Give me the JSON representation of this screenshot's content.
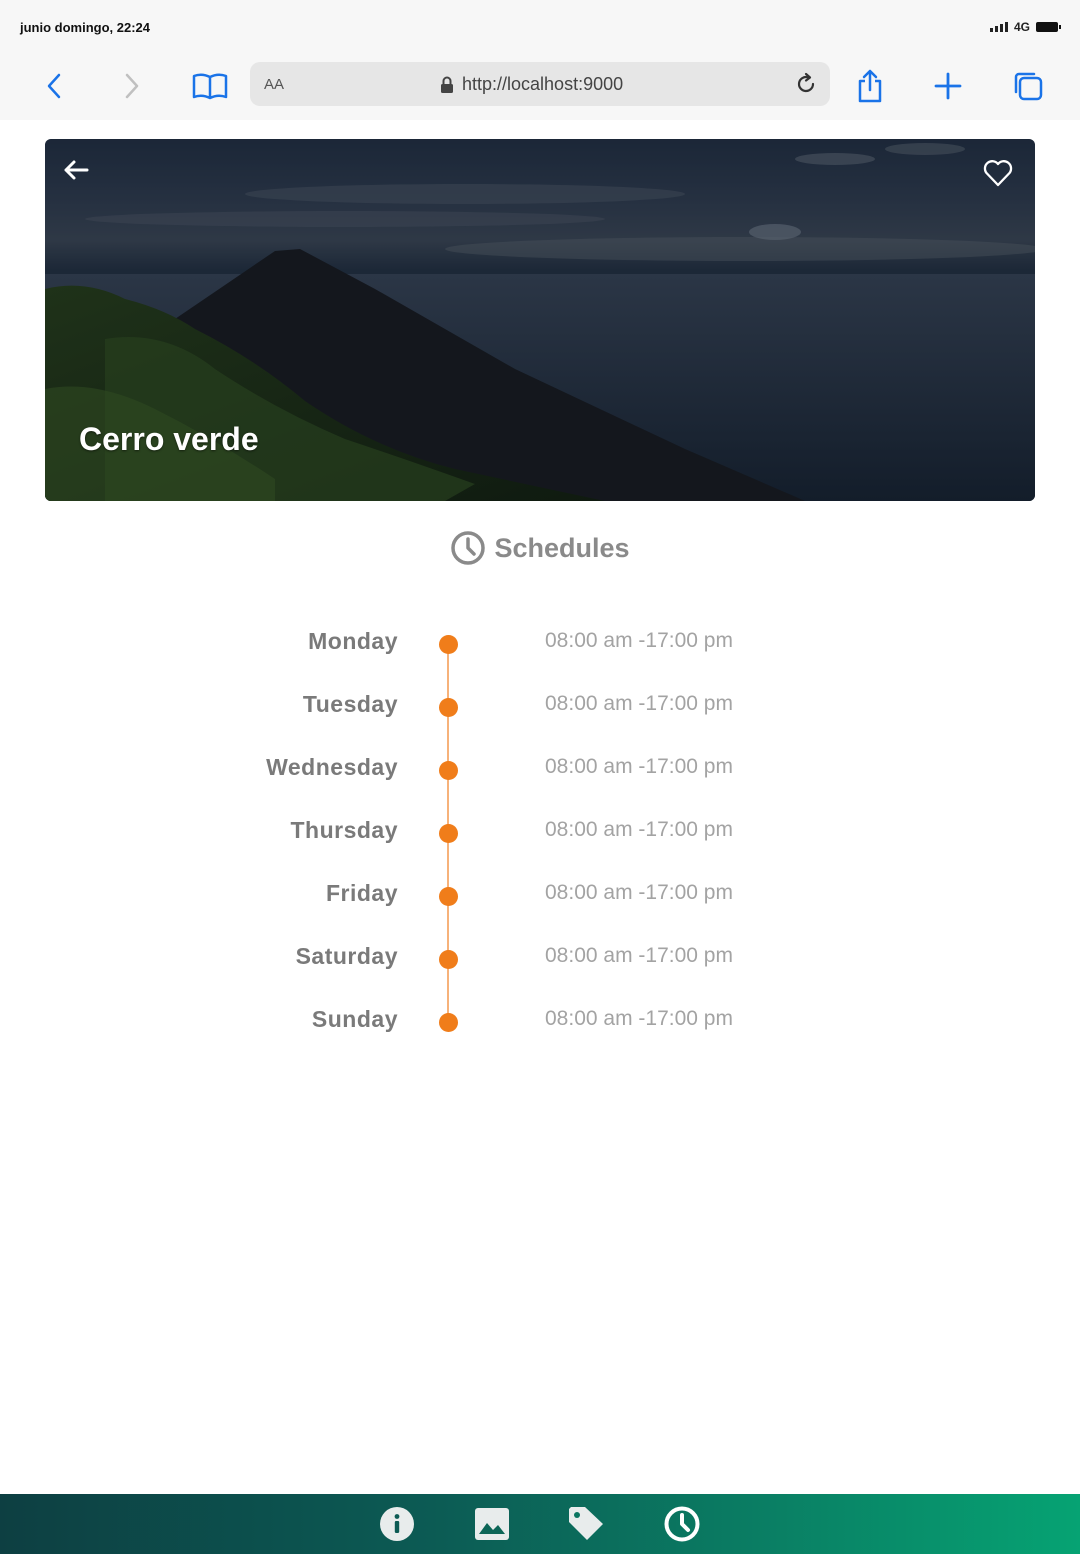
{
  "status_bar": {
    "time": "junio domingo, 22:24",
    "network": "4G"
  },
  "browser": {
    "text_size_label": "AA",
    "url": "http://localhost:9000"
  },
  "place": {
    "name": "Cerro verde"
  },
  "schedules": {
    "heading": "Schedules",
    "days": [
      {
        "day": "Monday",
        "hours": "08:00 am -17:00 pm"
      },
      {
        "day": "Tuesday",
        "hours": "08:00 am -17:00 pm"
      },
      {
        "day": "Wednesday",
        "hours": "08:00 am -17:00 pm"
      },
      {
        "day": "Thursday",
        "hours": "08:00 am -17:00 pm"
      },
      {
        "day": "Friday",
        "hours": "08:00 am -17:00 pm"
      },
      {
        "day": "Saturday",
        "hours": "08:00 am -17:00 pm"
      },
      {
        "day": "Sunday",
        "hours": "08:00 am -17:00 pm"
      }
    ]
  },
  "bottom_nav": {
    "items": [
      "info-icon",
      "image-icon",
      "tag-icon",
      "clock-icon"
    ]
  },
  "colors": {
    "accent": "#f07d1a",
    "browser_blue": "#1a73e8",
    "nav_gradient_start": "#0d3f42",
    "nav_gradient_end": "#06a373"
  }
}
